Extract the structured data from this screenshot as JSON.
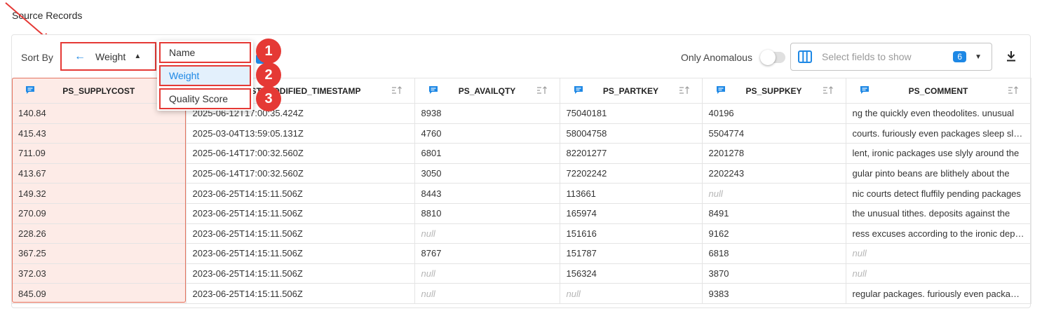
{
  "section_title": "Source Records",
  "toolbar": {
    "sort_by_label": "Sort By",
    "sort_value": "Weight",
    "only_anomalous_label": "Only Anomalous",
    "field_select_placeholder": "Select fields to show",
    "field_count": "6"
  },
  "sort_dropdown": {
    "options": [
      "Name",
      "Weight",
      "Quality Score"
    ],
    "selected": "Weight"
  },
  "callouts": [
    "1",
    "2",
    "3"
  ],
  "table": {
    "columns": [
      "PS_SUPPLYCOST",
      "LAST_MODIFIED_TIMESTAMP",
      "PS_AVAILQTY",
      "PS_PARTKEY",
      "PS_SUPPKEY",
      "PS_COMMENT"
    ],
    "rows": [
      [
        "140.84",
        "2025-06-12T17:00:35.424Z",
        "8938",
        "75040181",
        "40196",
        "ng the quickly even theodolites. unusual"
      ],
      [
        "415.43",
        "2025-03-04T13:59:05.131Z",
        "4760",
        "58004758",
        "5504774",
        "courts. furiously even packages sleep slyly"
      ],
      [
        "711.09",
        "2025-06-14T17:00:32.560Z",
        "6801",
        "82201277",
        "2201278",
        "lent, ironic packages use slyly around the"
      ],
      [
        "413.67",
        "2025-06-14T17:00:32.560Z",
        "3050",
        "72202242",
        "2202243",
        "gular pinto beans are blithely about the"
      ],
      [
        "149.32",
        "2023-06-25T14:15:11.506Z",
        "8443",
        "113661",
        "null",
        "nic courts detect fluffily pending packages"
      ],
      [
        "270.09",
        "2023-06-25T14:15:11.506Z",
        "8810",
        "165974",
        "8491",
        "the unusual tithes. deposits against the"
      ],
      [
        "228.26",
        "2023-06-25T14:15:11.506Z",
        "null",
        "151616",
        "9162",
        "ress excuses according to the ironic deposits"
      ],
      [
        "367.25",
        "2023-06-25T14:15:11.506Z",
        "8767",
        "151787",
        "6818",
        "null"
      ],
      [
        "372.03",
        "2023-06-25T14:15:11.506Z",
        "null",
        "156324",
        "3870",
        "null"
      ],
      [
        "845.09",
        "2023-06-25T14:15:11.506Z",
        "null",
        "null",
        "9383",
        "regular packages. furiously even packages"
      ]
    ]
  },
  "colors": {
    "accent": "#1e88e5",
    "annotation_red": "#e53935",
    "highlight_column": "#fdebe7"
  }
}
